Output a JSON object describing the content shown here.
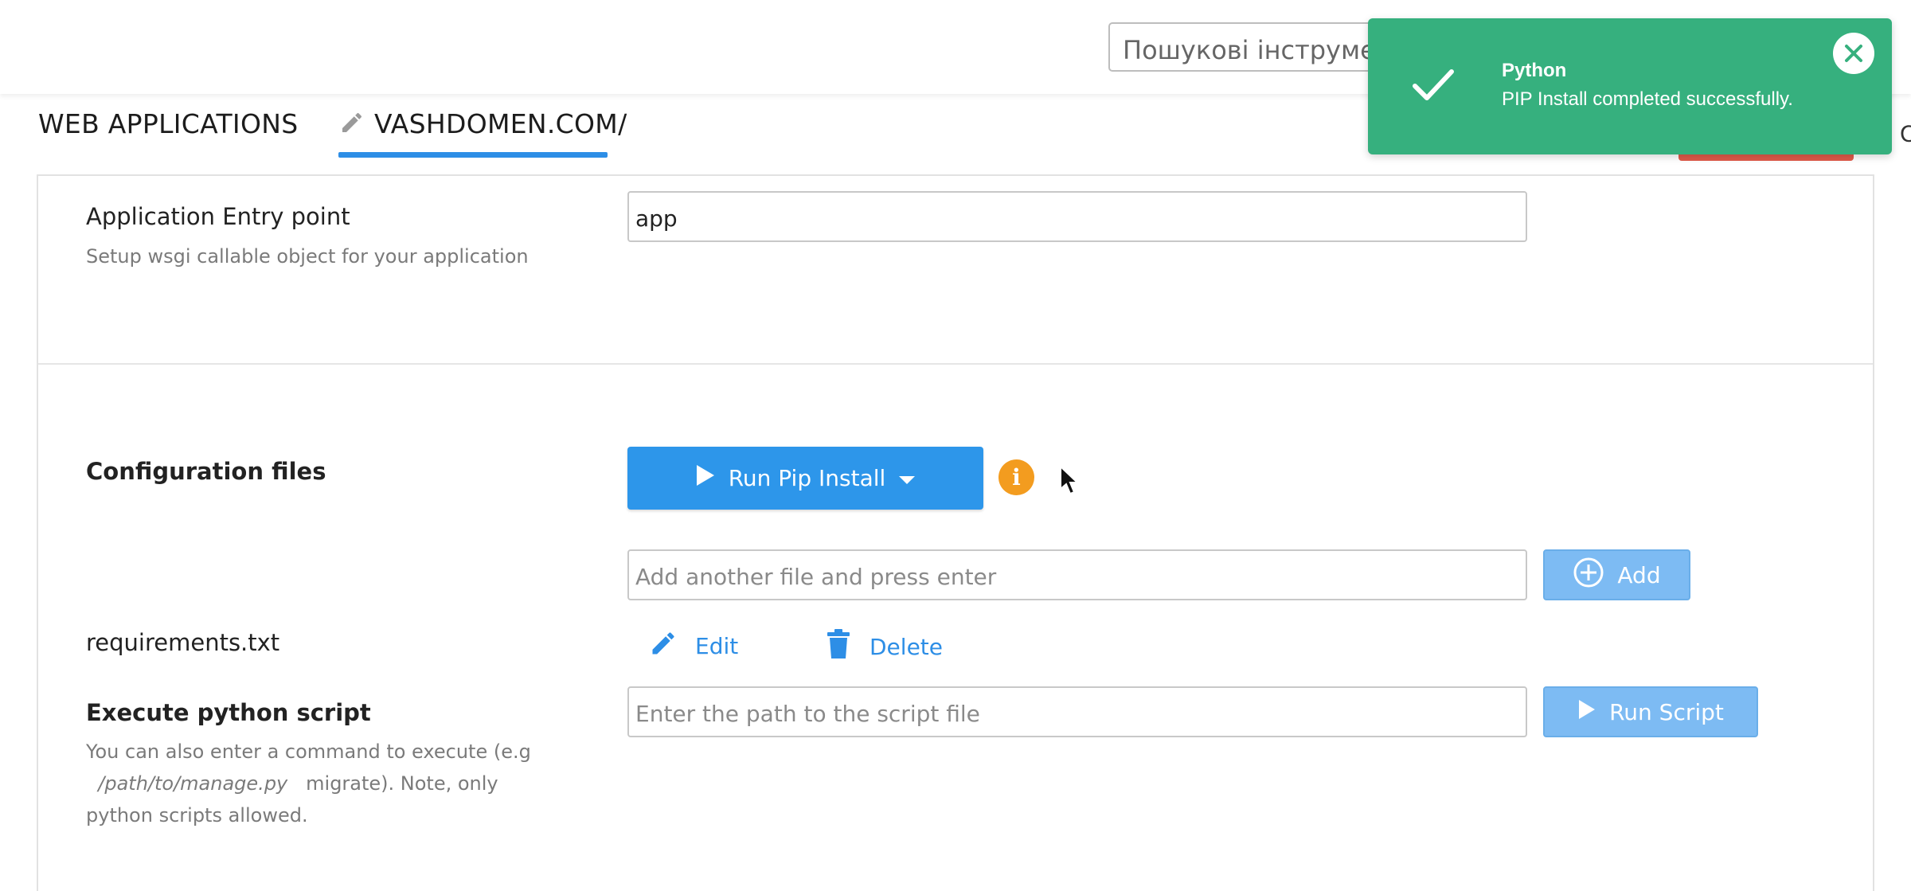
{
  "header": {
    "search_placeholder": "Пошукові інструменти",
    "edge_char": "C"
  },
  "tabs": [
    {
      "label": "WEB APPLICATIONS",
      "active": false
    },
    {
      "label": "VASHDOMEN.COM/",
      "active": true
    }
  ],
  "entry_point": {
    "label": "Application Entry point",
    "help": "Setup wsgi callable object for your application",
    "value": "app"
  },
  "config_files": {
    "label": "Configuration files",
    "run_button_label": "Run Pip Install",
    "add_placeholder": "Add another file and press enter",
    "add_button_label": "Add",
    "files": [
      {
        "name": "requirements.txt",
        "edit_label": "Edit",
        "delete_label": "Delete"
      }
    ]
  },
  "execute_script": {
    "label": "Execute python script",
    "help_prefix": "You can also enter a command to execute (e.g",
    "help_path": "/path/to/manage.py",
    "help_suffix": "migrate). Note, only python scripts allowed.",
    "input_placeholder": "Enter the path to the script file",
    "run_button_label": "Run Script"
  },
  "toast": {
    "title": "Python",
    "message": "PIP Install completed successfully.",
    "type": "success"
  },
  "colors": {
    "primary": "#2d96ea",
    "primary_light": "#7dbbf3",
    "success": "#36b07e",
    "warning": "#f39c1f",
    "danger": "#e05a4a",
    "link": "#2d8ee6"
  },
  "icons": [
    "pencil-icon",
    "play-icon",
    "caret-down-icon",
    "info-icon",
    "cursor-icon",
    "plus-circle-icon",
    "edit-pencil-icon",
    "trash-icon",
    "checkmark-icon",
    "close-icon"
  ]
}
